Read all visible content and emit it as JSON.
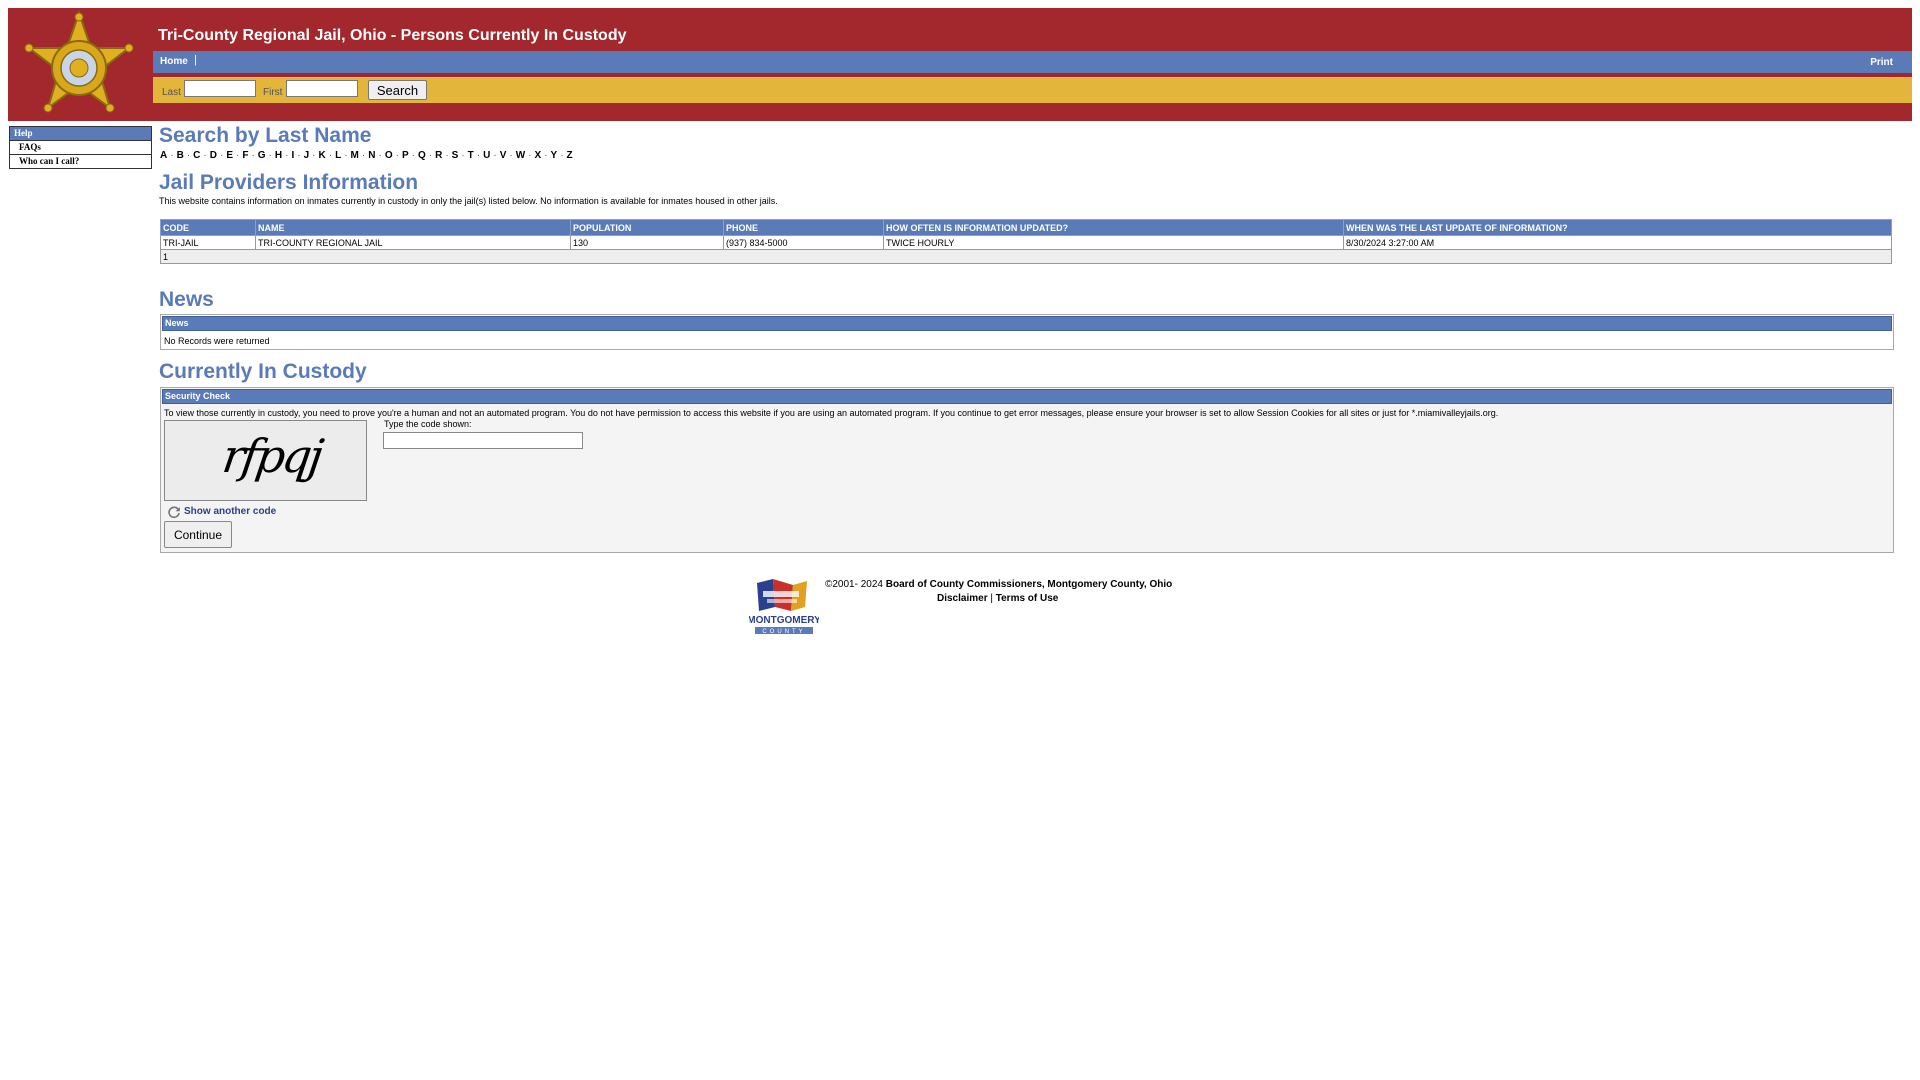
{
  "header": {
    "title": "Tri-County Regional Jail, Ohio - Persons Currently In Custody",
    "nav": {
      "home_label": "Home",
      "separator": "|",
      "print_label": "Print"
    },
    "search": {
      "last_label": "Last",
      "last_value": "",
      "first_label": "First",
      "first_value": "",
      "button_label": "Search"
    },
    "badge_icon": "sheriff-star-badge-icon",
    "colors": {
      "header_bg": "#a3282e",
      "nav_bg": "#5a7bb8",
      "search_bg": "#e3b53b"
    }
  },
  "sidebar": {
    "heading": "Help",
    "items": [
      {
        "label": "FAQs"
      },
      {
        "label": "Who can I call?"
      }
    ]
  },
  "search_by_last_name": {
    "title": "Search by Last Name",
    "letters": [
      "A",
      "B",
      "C",
      "D",
      "E",
      "F",
      "G",
      "H",
      "I",
      "J",
      "K",
      "L",
      "M",
      "N",
      "O",
      "P",
      "Q",
      "R",
      "S",
      "T",
      "U",
      "V",
      "W",
      "X",
      "Y",
      "Z"
    ]
  },
  "jail_providers": {
    "title": "Jail Providers Information",
    "description": "This website contains information on inmates currently in custody in only the jail(s) listed below. No information is available for inmates housed in other jails.",
    "columns": [
      "CODE",
      "NAME",
      "POPULATION",
      "PHONE",
      "HOW OFTEN IS INFORMATION UPDATED?",
      "WHEN WAS THE LAST UPDATE OF INFORMATION?"
    ],
    "rows": [
      [
        "TRI-JAIL",
        "TRI-COUNTY REGIONAL JAIL",
        "130",
        "(937) 834-5000",
        "TWICE HOURLY",
        "8/30/2024 3:27:00 AM"
      ]
    ],
    "page": "1"
  },
  "news": {
    "title": "News",
    "panel_title": "News",
    "empty_text": "No Records were returned"
  },
  "custody": {
    "title": "Currently In Custody",
    "panel_title": "Security Check",
    "notice": "To view those currently in custody, you need to prove you're a human and not an automated program. You do not have permission to access this website if you are using an automated program. If you continue to get error messages, please ensure your browser is set to allow Session Cookies for all sites or just for *.miamivalleyjails.org.",
    "captcha_code": "rfpqj",
    "captcha_label": "Type the code shown:",
    "captcha_value": "",
    "refresh_icon": "refresh-icon",
    "show_another_label": "Show another code",
    "continue_label": "Continue"
  },
  "footer": {
    "copyright": "©2001- 2024 ",
    "org_link": "Board of County Commissioners, Montgomery County, Ohio",
    "disclaimer_label": "Disclaimer",
    "separator": " | ",
    "terms_label": "Terms of Use",
    "logo_text": "MONTGOMERY",
    "logo_subtext": "COUNTY"
  }
}
